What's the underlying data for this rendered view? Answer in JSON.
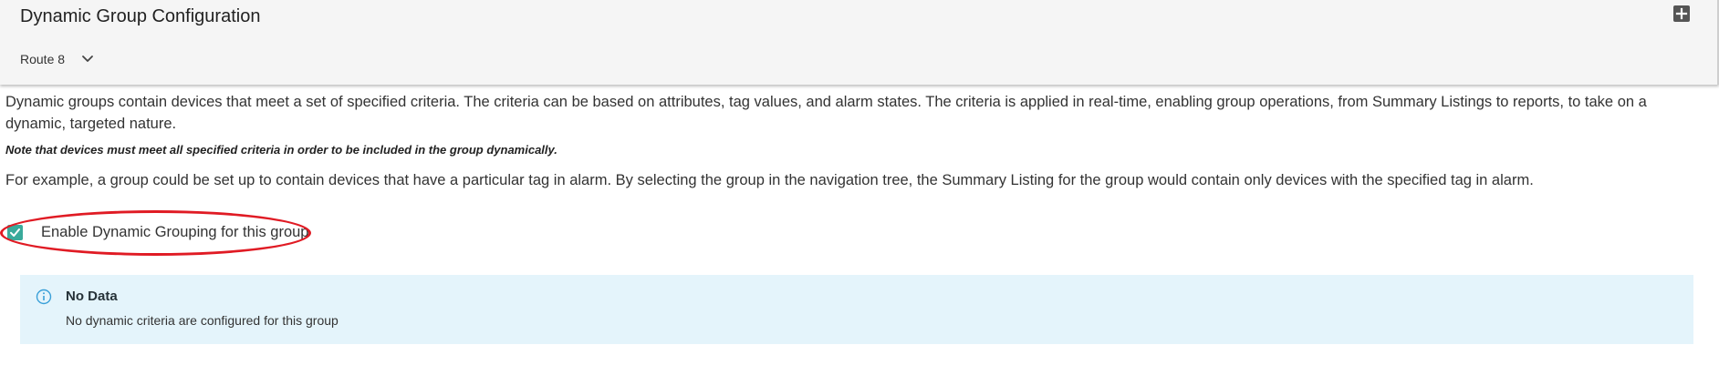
{
  "header": {
    "title": "Dynamic Group Configuration",
    "route_select_value": "Route 8",
    "add_icon": "plus-square-icon"
  },
  "content": {
    "description": "Dynamic groups contain devices that meet a set of specified criteria. The criteria can be based on attributes, tag values, and alarm states. The criteria is applied in real-time, enabling group operations, from Summary Listings to reports, to take on a dynamic, targeted nature.",
    "note": "Note that devices must meet all specified criteria in order to be included in the group dynamically.",
    "example": "For example, a group could be set up to contain devices that have a particular tag in alarm. By selecting the group in the navigation tree, the Summary Listing for the group would contain only devices with the specified tag in alarm."
  },
  "checkbox": {
    "label": "Enable Dynamic Grouping for this group",
    "checked": true,
    "color": "#3aaa9b"
  },
  "highlight": {
    "color": "#e01b24"
  },
  "notice": {
    "icon": "info-circle-icon",
    "title": "No Data",
    "text": "No dynamic criteria are configured for this group",
    "background": "#e4f4fb"
  }
}
